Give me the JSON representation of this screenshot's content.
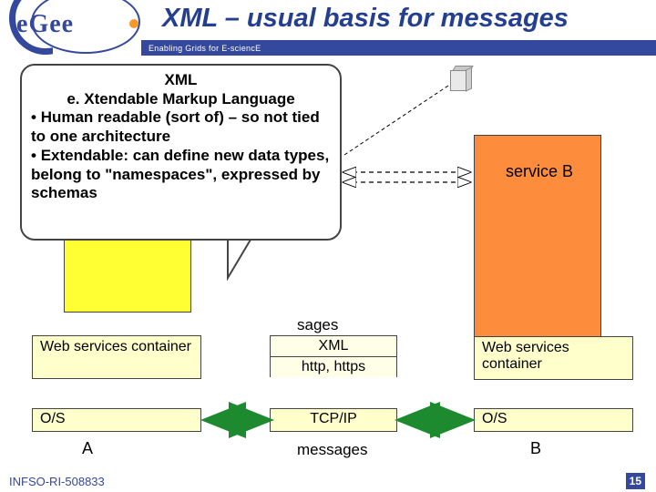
{
  "header": {
    "title": "XML – usual basis for messages",
    "tagline": "Enabling Grids for E-sciencE",
    "logo_text": "eGee"
  },
  "callout": {
    "heading": "XML",
    "subheading": "e. Xtendable Markup Language",
    "bullets": [
      "Human readable (sort of) – so not tied to one architecture",
      "Extendable: can define new data types, belong to \"namespaces\", expressed by schemas"
    ]
  },
  "diagram": {
    "service_a_label": "",
    "service_b_label": "service B",
    "sages_fragment": "sages",
    "ws_container_a": "Web services container",
    "ws_container_b": "Web services container",
    "stack": {
      "xml": "XML",
      "http": "http, https",
      "tcp": "TCP/IP"
    },
    "os_a": "O/S",
    "os_b": "O/S",
    "node_a": "A",
    "node_b": "B",
    "messages": "messages"
  },
  "footer": {
    "left": "INFSO-RI-508833",
    "page": "15"
  }
}
